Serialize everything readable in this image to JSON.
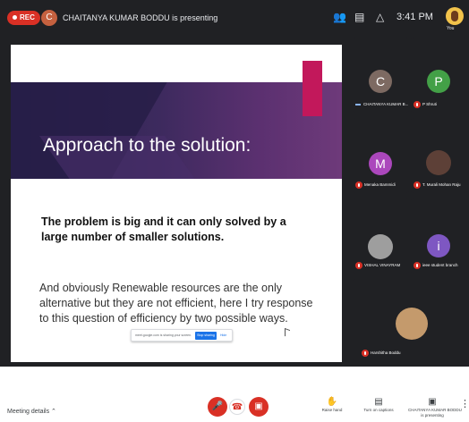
{
  "top_bar": {
    "rec_label": "REC",
    "presenter_initial": "C",
    "presenter_text": "CHAITANYA KUMAR BODDU is presenting",
    "icons": [
      "people-icon",
      "chat-icon",
      "activities-icon"
    ],
    "time": "3:41 PM",
    "self_label": "You"
  },
  "slide": {
    "title": "Approach to the solution:",
    "bold_text": "The problem is big and it can only solved by a large number of smaller solutions.",
    "body_text": "And obviously Renewable resources are the only alternative but they are not efficient, here I try response to this question of efficiency by two possible ways."
  },
  "share_prompt": {
    "text": "meet.google.com is sharing your screen.",
    "stop_label": "Stop sharing",
    "hide_label": "Hide"
  },
  "participants": [
    {
      "name": "CHAITANYA KUMAR B...",
      "initial": "C",
      "color": "#7d6a62",
      "kind": "letter",
      "speaking": true
    },
    {
      "name": "P Shruti",
      "initial": "P",
      "color": "#43a047",
      "kind": "letter",
      "muted": true
    },
    {
      "name": "Menaka Bammidi",
      "initial": "M",
      "color": "#ab47bc",
      "kind": "letter",
      "muted": true
    },
    {
      "name": "T. Murali Mohan Raju",
      "initial": "",
      "color": "#5d4037",
      "kind": "photo",
      "muted": true
    },
    {
      "name": "VISHAL VINAYRAM",
      "initial": "",
      "color": "#9e9e9e",
      "kind": "photo",
      "muted": true
    },
    {
      "name": "ieee student branch",
      "initial": "i",
      "color": "#7e57c2",
      "kind": "letter",
      "muted": true
    },
    {
      "name": "Harshitha Boddu",
      "initial": "",
      "color": "#c49a6c",
      "kind": "photo",
      "muted": true
    }
  ],
  "bottom_bar": {
    "meeting_details": "Meeting details",
    "raise_hand": "Raise hand",
    "captions": "Turn on captions",
    "present_line1": "CHAITANYA KUMAR BODDU",
    "present_line2": "is presenting"
  },
  "colors": {
    "dark_bg": "#202124",
    "tile_bg": "#3c4043",
    "danger": "#d93025",
    "accent": "#1a73e8"
  }
}
